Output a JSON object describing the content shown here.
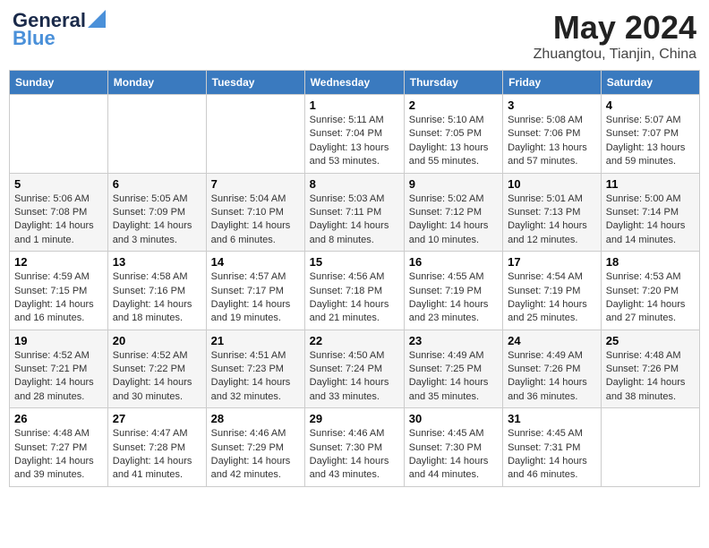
{
  "logo": {
    "line1": "General",
    "line2": "Blue"
  },
  "title": "May 2024",
  "location": "Zhuangtou, Tianjin, China",
  "days_of_week": [
    "Sunday",
    "Monday",
    "Tuesday",
    "Wednesday",
    "Thursday",
    "Friday",
    "Saturday"
  ],
  "weeks": [
    [
      {
        "day": "",
        "info": ""
      },
      {
        "day": "",
        "info": ""
      },
      {
        "day": "",
        "info": ""
      },
      {
        "day": "1",
        "sunrise": "Sunrise: 5:11 AM",
        "sunset": "Sunset: 7:04 PM",
        "daylight": "Daylight: 13 hours and 53 minutes."
      },
      {
        "day": "2",
        "sunrise": "Sunrise: 5:10 AM",
        "sunset": "Sunset: 7:05 PM",
        "daylight": "Daylight: 13 hours and 55 minutes."
      },
      {
        "day": "3",
        "sunrise": "Sunrise: 5:08 AM",
        "sunset": "Sunset: 7:06 PM",
        "daylight": "Daylight: 13 hours and 57 minutes."
      },
      {
        "day": "4",
        "sunrise": "Sunrise: 5:07 AM",
        "sunset": "Sunset: 7:07 PM",
        "daylight": "Daylight: 13 hours and 59 minutes."
      }
    ],
    [
      {
        "day": "5",
        "sunrise": "Sunrise: 5:06 AM",
        "sunset": "Sunset: 7:08 PM",
        "daylight": "Daylight: 14 hours and 1 minute."
      },
      {
        "day": "6",
        "sunrise": "Sunrise: 5:05 AM",
        "sunset": "Sunset: 7:09 PM",
        "daylight": "Daylight: 14 hours and 3 minutes."
      },
      {
        "day": "7",
        "sunrise": "Sunrise: 5:04 AM",
        "sunset": "Sunset: 7:10 PM",
        "daylight": "Daylight: 14 hours and 6 minutes."
      },
      {
        "day": "8",
        "sunrise": "Sunrise: 5:03 AM",
        "sunset": "Sunset: 7:11 PM",
        "daylight": "Daylight: 14 hours and 8 minutes."
      },
      {
        "day": "9",
        "sunrise": "Sunrise: 5:02 AM",
        "sunset": "Sunset: 7:12 PM",
        "daylight": "Daylight: 14 hours and 10 minutes."
      },
      {
        "day": "10",
        "sunrise": "Sunrise: 5:01 AM",
        "sunset": "Sunset: 7:13 PM",
        "daylight": "Daylight: 14 hours and 12 minutes."
      },
      {
        "day": "11",
        "sunrise": "Sunrise: 5:00 AM",
        "sunset": "Sunset: 7:14 PM",
        "daylight": "Daylight: 14 hours and 14 minutes."
      }
    ],
    [
      {
        "day": "12",
        "sunrise": "Sunrise: 4:59 AM",
        "sunset": "Sunset: 7:15 PM",
        "daylight": "Daylight: 14 hours and 16 minutes."
      },
      {
        "day": "13",
        "sunrise": "Sunrise: 4:58 AM",
        "sunset": "Sunset: 7:16 PM",
        "daylight": "Daylight: 14 hours and 18 minutes."
      },
      {
        "day": "14",
        "sunrise": "Sunrise: 4:57 AM",
        "sunset": "Sunset: 7:17 PM",
        "daylight": "Daylight: 14 hours and 19 minutes."
      },
      {
        "day": "15",
        "sunrise": "Sunrise: 4:56 AM",
        "sunset": "Sunset: 7:18 PM",
        "daylight": "Daylight: 14 hours and 21 minutes."
      },
      {
        "day": "16",
        "sunrise": "Sunrise: 4:55 AM",
        "sunset": "Sunset: 7:19 PM",
        "daylight": "Daylight: 14 hours and 23 minutes."
      },
      {
        "day": "17",
        "sunrise": "Sunrise: 4:54 AM",
        "sunset": "Sunset: 7:19 PM",
        "daylight": "Daylight: 14 hours and 25 minutes."
      },
      {
        "day": "18",
        "sunrise": "Sunrise: 4:53 AM",
        "sunset": "Sunset: 7:20 PM",
        "daylight": "Daylight: 14 hours and 27 minutes."
      }
    ],
    [
      {
        "day": "19",
        "sunrise": "Sunrise: 4:52 AM",
        "sunset": "Sunset: 7:21 PM",
        "daylight": "Daylight: 14 hours and 28 minutes."
      },
      {
        "day": "20",
        "sunrise": "Sunrise: 4:52 AM",
        "sunset": "Sunset: 7:22 PM",
        "daylight": "Daylight: 14 hours and 30 minutes."
      },
      {
        "day": "21",
        "sunrise": "Sunrise: 4:51 AM",
        "sunset": "Sunset: 7:23 PM",
        "daylight": "Daylight: 14 hours and 32 minutes."
      },
      {
        "day": "22",
        "sunrise": "Sunrise: 4:50 AM",
        "sunset": "Sunset: 7:24 PM",
        "daylight": "Daylight: 14 hours and 33 minutes."
      },
      {
        "day": "23",
        "sunrise": "Sunrise: 4:49 AM",
        "sunset": "Sunset: 7:25 PM",
        "daylight": "Daylight: 14 hours and 35 minutes."
      },
      {
        "day": "24",
        "sunrise": "Sunrise: 4:49 AM",
        "sunset": "Sunset: 7:26 PM",
        "daylight": "Daylight: 14 hours and 36 minutes."
      },
      {
        "day": "25",
        "sunrise": "Sunrise: 4:48 AM",
        "sunset": "Sunset: 7:26 PM",
        "daylight": "Daylight: 14 hours and 38 minutes."
      }
    ],
    [
      {
        "day": "26",
        "sunrise": "Sunrise: 4:48 AM",
        "sunset": "Sunset: 7:27 PM",
        "daylight": "Daylight: 14 hours and 39 minutes."
      },
      {
        "day": "27",
        "sunrise": "Sunrise: 4:47 AM",
        "sunset": "Sunset: 7:28 PM",
        "daylight": "Daylight: 14 hours and 41 minutes."
      },
      {
        "day": "28",
        "sunrise": "Sunrise: 4:46 AM",
        "sunset": "Sunset: 7:29 PM",
        "daylight": "Daylight: 14 hours and 42 minutes."
      },
      {
        "day": "29",
        "sunrise": "Sunrise: 4:46 AM",
        "sunset": "Sunset: 7:30 PM",
        "daylight": "Daylight: 14 hours and 43 minutes."
      },
      {
        "day": "30",
        "sunrise": "Sunrise: 4:45 AM",
        "sunset": "Sunset: 7:30 PM",
        "daylight": "Daylight: 14 hours and 44 minutes."
      },
      {
        "day": "31",
        "sunrise": "Sunrise: 4:45 AM",
        "sunset": "Sunset: 7:31 PM",
        "daylight": "Daylight: 14 hours and 46 minutes."
      },
      {
        "day": "",
        "info": ""
      }
    ]
  ]
}
